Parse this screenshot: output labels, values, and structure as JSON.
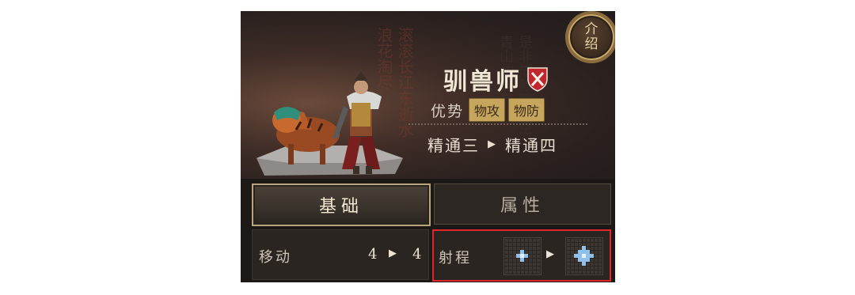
{
  "unit": {
    "name": "驯兽师",
    "intro_button": [
      "介",
      "绍"
    ],
    "advantage_label": "优势",
    "advantage_tags": [
      "物攻",
      "物防"
    ],
    "mastery_from": "精通三",
    "mastery_to": "精通四"
  },
  "tabs": {
    "basic": "基础",
    "attributes": "属性",
    "active": "basic"
  },
  "stats": {
    "move": {
      "label": "移动",
      "from": "4",
      "to": "4"
    },
    "range": {
      "label": "射程"
    }
  },
  "colors": {
    "accent_gold": "#c6a55c",
    "highlight_red": "#e0262a",
    "shield_red": "#c0262c",
    "range_cell_blue": "#8fc0ea"
  },
  "icons": {
    "class_badge": "shield-crossed-swords-icon",
    "arrow": "play-triangle-icon"
  }
}
